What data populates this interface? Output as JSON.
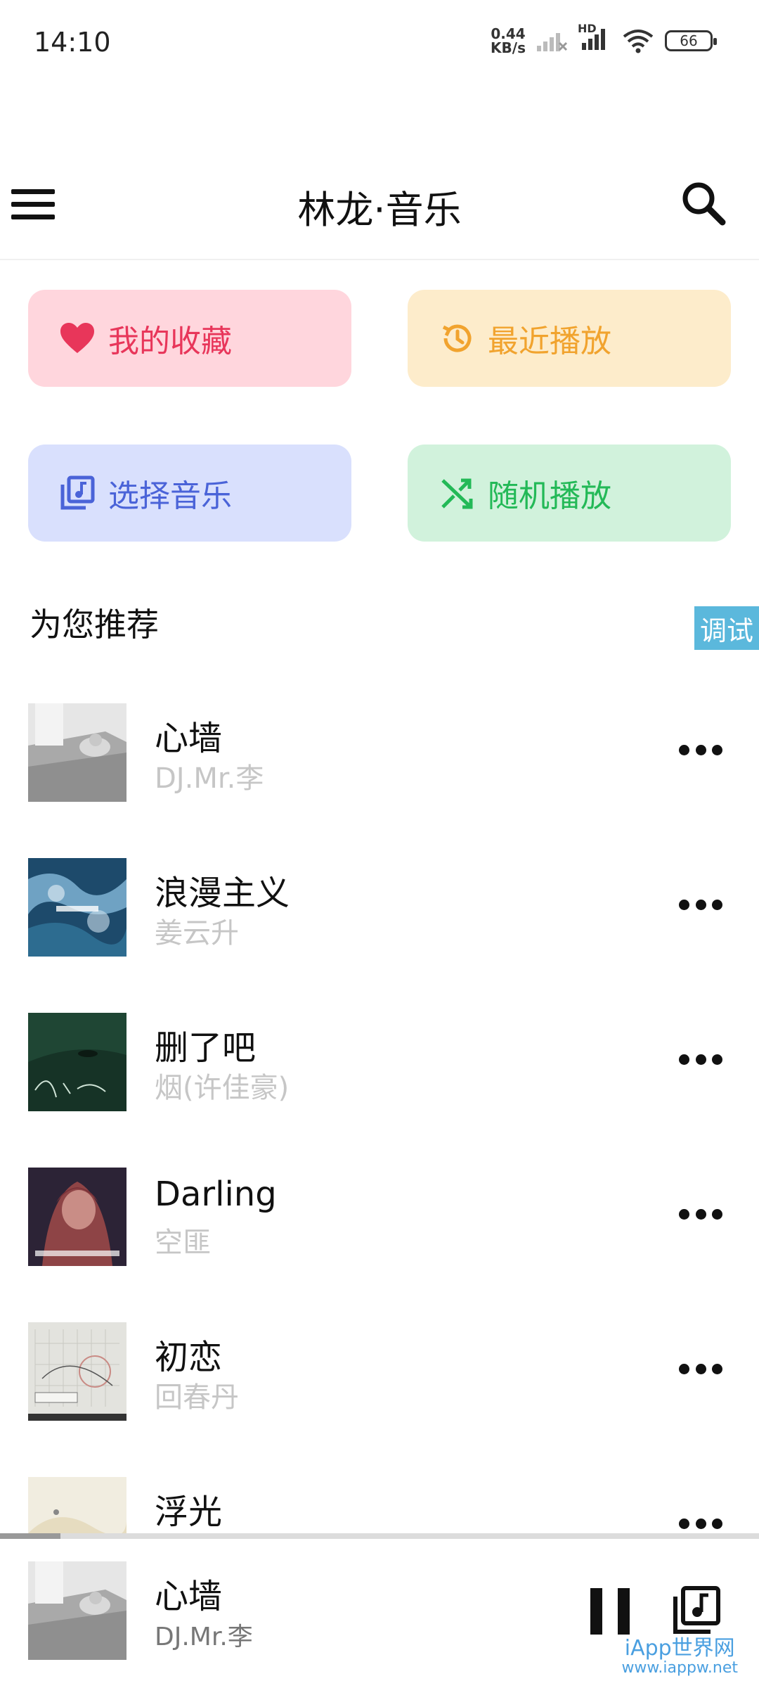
{
  "status_bar": {
    "time": "14:10",
    "net_speed_value": "0.44",
    "net_speed_unit": "KB/s",
    "hd_label": "HD",
    "battery": "66"
  },
  "header": {
    "title": "林龙·音乐",
    "menu_icon": "hamburger-menu-icon",
    "search_icon": "search-icon"
  },
  "quick_actions": [
    {
      "label": "我的收藏",
      "icon": "heart-icon",
      "color": "#e8365a",
      "bg": "#ffd6dd"
    },
    {
      "label": "最近播放",
      "icon": "history-icon",
      "color": "#f1a32e",
      "bg": "#fdeccb"
    },
    {
      "label": "选择音乐",
      "icon": "music-library-icon",
      "color": "#4a63d8",
      "bg": "#d9e0fd"
    },
    {
      "label": "随机播放",
      "icon": "shuffle-icon",
      "color": "#23b957",
      "bg": "#d1f2dc"
    }
  ],
  "recommend": {
    "title": "为您推荐",
    "debug_label": "调试"
  },
  "songs": [
    {
      "title": "心墙",
      "artist": "DJ.Mr.李"
    },
    {
      "title": "浪漫主义",
      "artist": "姜云升"
    },
    {
      "title": "删了吧",
      "artist": "烟(许佳豪)"
    },
    {
      "title": "Darling",
      "artist": "空匪"
    },
    {
      "title": "初恋",
      "artist": "回春丹"
    },
    {
      "title": "浮光",
      "artist": ""
    }
  ],
  "player": {
    "title": "心墙",
    "artist": "DJ.Mr.李",
    "progress": 0.08
  },
  "watermark": {
    "line1": "iApp世界网",
    "line2": "www.iappw.net"
  }
}
